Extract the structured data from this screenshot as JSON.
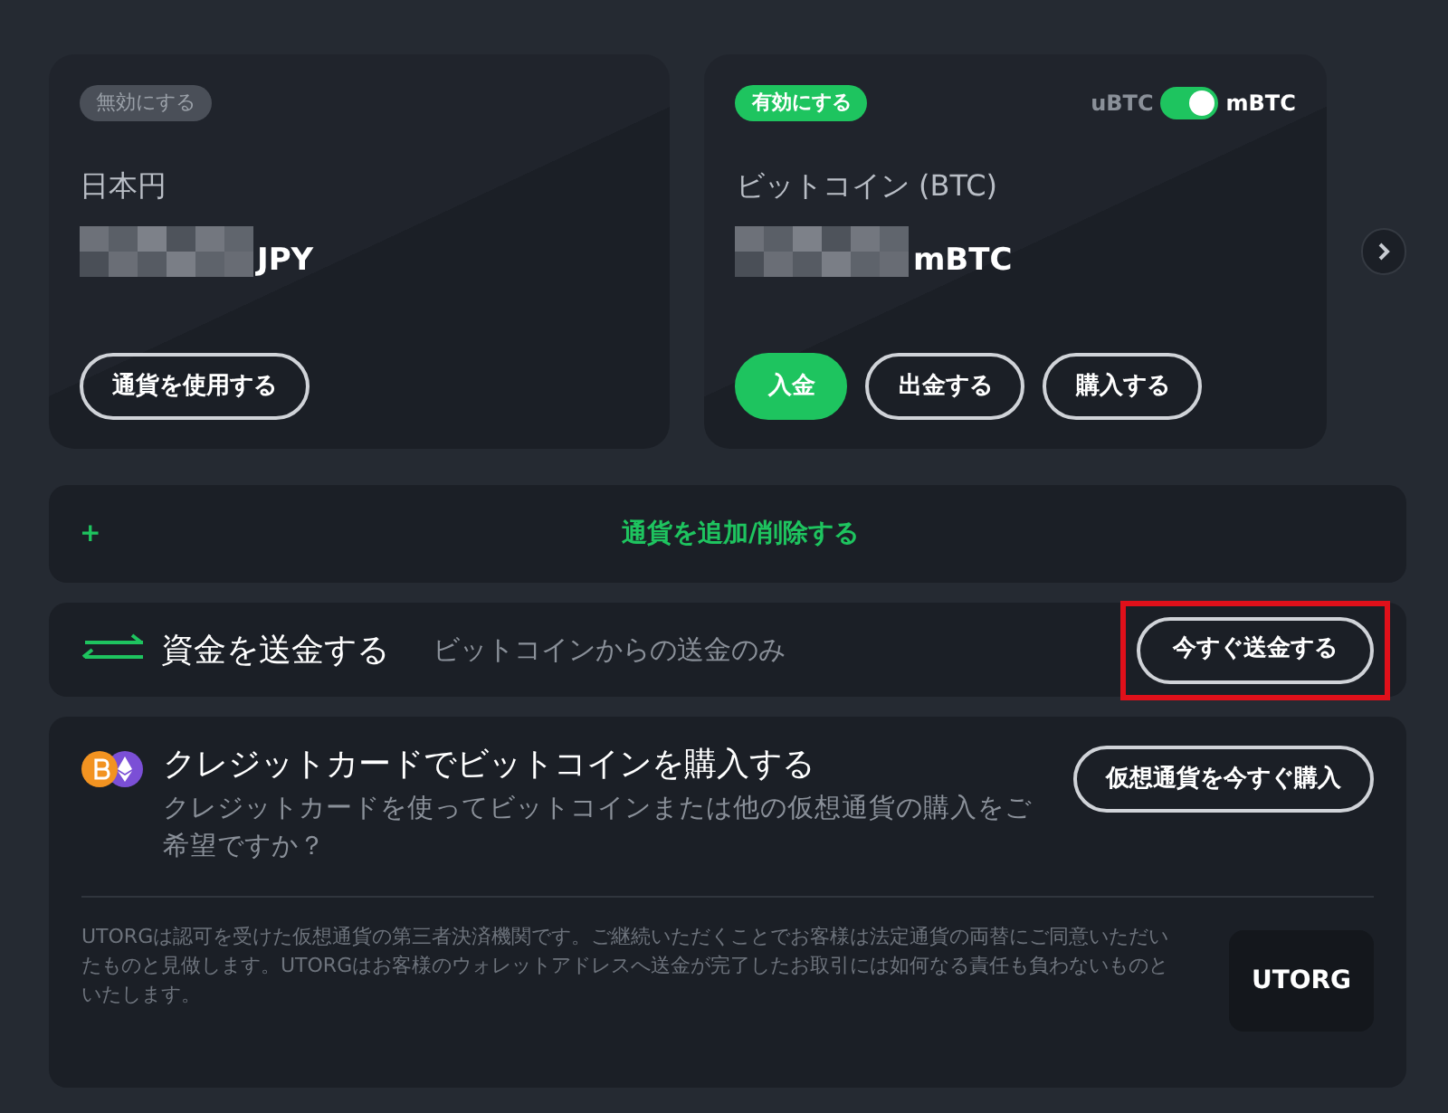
{
  "wallets": [
    {
      "status": {
        "label": "無効にする",
        "active": false
      },
      "name": "日本円",
      "unit": "JPY",
      "buttons": [
        {
          "label": "通貨を使用する",
          "kind": "outline"
        }
      ]
    },
    {
      "status": {
        "label": "有効にする",
        "active": true
      },
      "unit_toggle": {
        "left": "uBTC",
        "right": "mBTC",
        "on": true
      },
      "name": "ビットコイン (BTC)",
      "unit": "mBTC",
      "buttons": [
        {
          "label": "入金",
          "kind": "primary"
        },
        {
          "label": "出金する",
          "kind": "outline"
        },
        {
          "label": "購入する",
          "kind": "outline"
        }
      ]
    }
  ],
  "add_row": {
    "icon": "+",
    "label": "通貨を追加/削除する"
  },
  "send_row": {
    "title": "資金を送金する",
    "note": "ビットコインからの送金のみ",
    "button": {
      "label": "今すぐ送金する",
      "highlighted": true
    }
  },
  "buy_panel": {
    "title": "クレジットカードでビットコインを購入する",
    "description": "クレジットカードを使ってビットコインまたは他の仮想通貨の購入をご希望ですか？",
    "button": "仮想通貨を今すぐ購入",
    "disclaimer": "UTORGは認可を受けた仮想通貨の第三者決済機関です。ご継続いただくことでお客様は法定通貨の両替にご同意いただいたものと見做します。UTORGはお客様のウォレットアドレスへ送金が完了したお取引には如何なる責任も負わないものといたします。",
    "logo": "UTORG"
  }
}
